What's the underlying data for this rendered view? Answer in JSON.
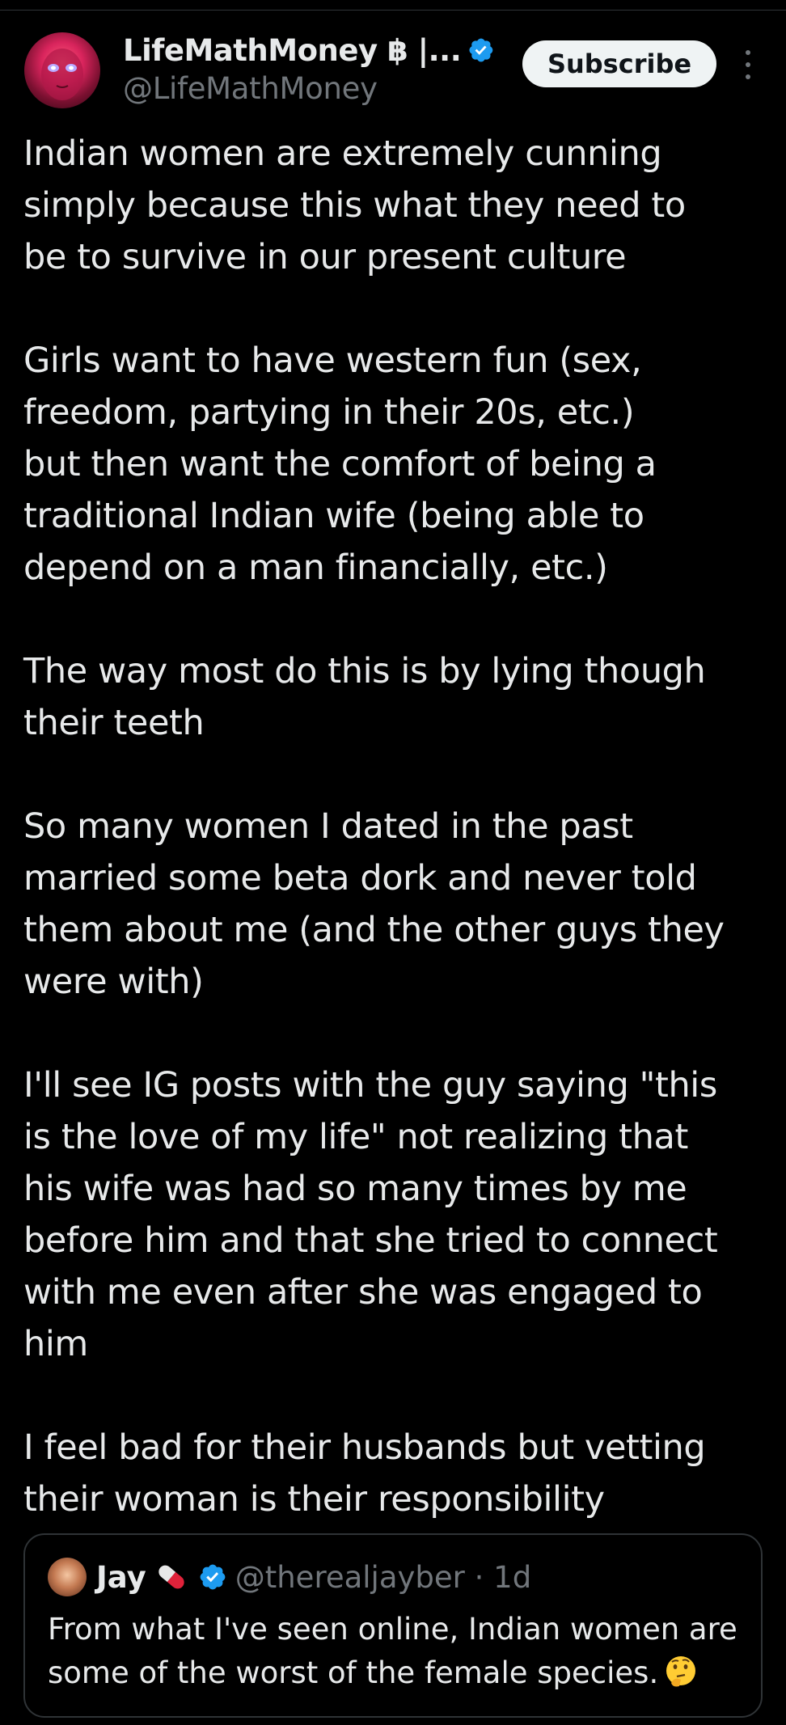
{
  "author": {
    "display_name": "LifeMathMoney ฿ |...",
    "handle": "@LifeMathMoney",
    "verified": true
  },
  "actions": {
    "subscribe_label": "Subscribe"
  },
  "tweet": {
    "paragraphs": [
      [
        "Indian women are extremely cunning",
        "simply because this what they need to",
        "be to survive in our present culture"
      ],
      [
        "Girls want to have western fun (sex,",
        "freedom, partying in their 20s, etc.)",
        "but then want the comfort of being a",
        "traditional Indian wife (being able to",
        "depend on a man financially, etc.)"
      ],
      [
        "The way most do this is by lying though",
        "their teeth"
      ],
      [
        "So many women I dated in the past",
        "married some beta dork and never told",
        "them about me (and the other guys they",
        "were with)"
      ],
      [
        "I'll see IG posts with the guy saying \"this",
        "is the love of my life\" not realizing that",
        "his wife was had so many times by me",
        "before him and that she tried to connect",
        "with me even after she was engaged to",
        "him"
      ],
      [
        "I feel bad for their husbands but vetting",
        "their woman is their responsibility"
      ]
    ]
  },
  "quoted_tweet": {
    "display_name": "Jay",
    "name_emoji": "pill-icon",
    "verified": true,
    "handle_time": "@therealjayber · 1d",
    "text_lines": [
      "From what I've seen online, Indian women are",
      "some of the worst of the female species."
    ],
    "trailing_emoji": "thinking-face-icon"
  },
  "colors": {
    "background": "#000000",
    "text": "#e7e9ea",
    "secondary_text": "#71767b",
    "verified_blue": "#1d9bf0",
    "border": "#2f3336",
    "button_bg": "#eff3f4"
  }
}
